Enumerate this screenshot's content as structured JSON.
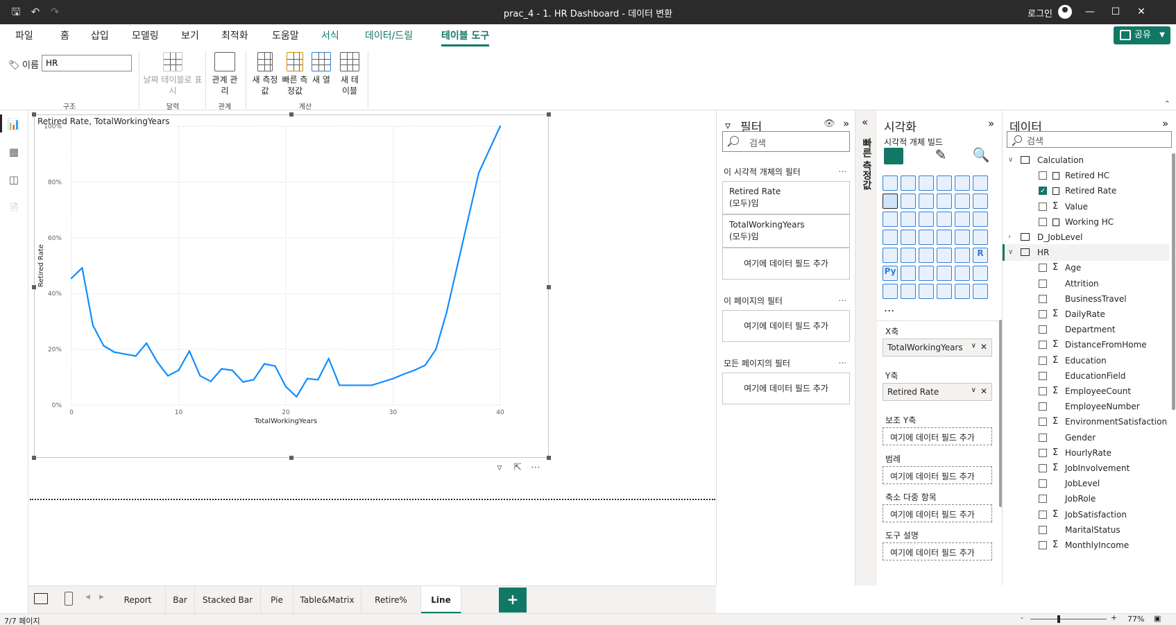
{
  "window": {
    "title": "prac_4 - 1. HR Dashboard - 데이터 변환",
    "login": "로그인"
  },
  "ribbon": {
    "tabs": [
      "파일",
      "홈",
      "삽입",
      "모델링",
      "보기",
      "최적화",
      "도움말",
      "서식",
      "데이터/드릴",
      "테이블 도구"
    ],
    "share": "공유",
    "name_label": "이름",
    "name_value": "HR",
    "groups": {
      "structure": "구조",
      "calendar": "달력",
      "relations": "관계",
      "calc": "계산"
    },
    "buttons": {
      "date_table": "날짜 테이블로 표시",
      "manage_rel": "관계 관리",
      "new_measure": "새 측정값",
      "quick_measure": "빠른 측정값",
      "new_column": "새 열",
      "new_table": "새 테이블"
    }
  },
  "visual": {
    "title": "Retired Rate, TotalWorkingYears"
  },
  "chart_data": {
    "type": "line",
    "xlabel": "TotalWorkingYears",
    "ylabel": "Retired Rate",
    "xlim": [
      0,
      40
    ],
    "ylim": [
      0,
      1
    ],
    "x_ticks": [
      "0",
      "10",
      "20",
      "30",
      "40"
    ],
    "y_ticks": [
      "0%",
      "20%",
      "40%",
      "60%",
      "80%",
      "100%"
    ],
    "grid": true,
    "color": "#118dff",
    "x": [
      0,
      1,
      2,
      3,
      4,
      5,
      6,
      7,
      8,
      9,
      10,
      11,
      12,
      13,
      14,
      15,
      16,
      17,
      18,
      19,
      20,
      21,
      22,
      23,
      24,
      25,
      26,
      27,
      28,
      29,
      30,
      31,
      32,
      33,
      34,
      35,
      36,
      37,
      38,
      39,
      40
    ],
    "values": [
      0.455,
      0.492,
      0.286,
      0.213,
      0.19,
      0.183,
      0.176,
      0.222,
      0.155,
      0.105,
      0.125,
      0.194,
      0.105,
      0.085,
      0.13,
      0.125,
      0.083,
      0.091,
      0.148,
      0.14,
      0.066,
      0.03,
      0.095,
      0.091,
      0.167,
      0.071,
      0.071,
      0.071,
      0.071,
      0.083,
      0.095,
      0.111,
      0.125,
      0.143,
      0.2,
      0.333,
      0.5,
      0.667,
      0.833,
      0.917,
      1.0
    ]
  },
  "filters": {
    "title": "필터",
    "search_placeholder": "검색",
    "visual_section": "이 시각적 개체의 필터",
    "cards": [
      {
        "name": "Retired Rate",
        "state": "(모두)임"
      },
      {
        "name": "TotalWorkingYears",
        "state": "(모두)임"
      }
    ],
    "add_field": "여기에 데이터 필드 추가",
    "page_section": "이 페이지의 필터",
    "all_pages_section": "모든 페이지의 필터",
    "more": "..."
  },
  "build_strip": {
    "label": "빠른 측정값"
  },
  "viz": {
    "title": "시각화",
    "subtitle": "시각적 개체 빌드",
    "more": "...",
    "wells": [
      {
        "label": "X축",
        "field": "TotalWorkingYears"
      },
      {
        "label": "Y축",
        "field": "Retired Rate"
      },
      {
        "label": "보조 Y축",
        "field": ""
      },
      {
        "label": "범례",
        "field": ""
      },
      {
        "label": "축소 다중 항목",
        "field": ""
      },
      {
        "label": "도구 설명",
        "field": ""
      }
    ],
    "add_field": "여기에 데이터 필드 추가",
    "py": "Py",
    "r": "R"
  },
  "data": {
    "title": "데이터",
    "search_placeholder": "검색",
    "tables": [
      {
        "name": "Calculation",
        "fields": [
          {
            "name": "Retired HC",
            "kind": "calc",
            "checked": false
          },
          {
            "name": "Retired Rate",
            "kind": "calc",
            "checked": true
          },
          {
            "name": "Value",
            "kind": "sum",
            "checked": false
          },
          {
            "name": "Working HC",
            "kind": "calc",
            "checked": false
          }
        ]
      },
      {
        "name": "D_JobLevel",
        "fields": []
      },
      {
        "name": "HR",
        "fields": [
          {
            "name": "Age",
            "kind": "sum"
          },
          {
            "name": "Attrition",
            "kind": "text"
          },
          {
            "name": "BusinessTravel",
            "kind": "text"
          },
          {
            "name": "DailyRate",
            "kind": "sum"
          },
          {
            "name": "Department",
            "kind": "text"
          },
          {
            "name": "DistanceFromHome",
            "kind": "sum"
          },
          {
            "name": "Education",
            "kind": "sum"
          },
          {
            "name": "EducationField",
            "kind": "text"
          },
          {
            "name": "EmployeeCount",
            "kind": "sum"
          },
          {
            "name": "EmployeeNumber",
            "kind": "text"
          },
          {
            "name": "EnvironmentSatisfaction",
            "kind": "sum"
          },
          {
            "name": "Gender",
            "kind": "text"
          },
          {
            "name": "HourlyRate",
            "kind": "sum"
          },
          {
            "name": "JobInvolvement",
            "kind": "sum"
          },
          {
            "name": "JobLevel",
            "kind": "text"
          },
          {
            "name": "JobRole",
            "kind": "text"
          },
          {
            "name": "JobSatisfaction",
            "kind": "sum"
          },
          {
            "name": "MaritalStatus",
            "kind": "text"
          },
          {
            "name": "MonthlyIncome",
            "kind": "sum"
          }
        ]
      }
    ]
  },
  "pages": {
    "tabs": [
      "Report",
      "Bar",
      "Stacked Bar",
      "Pie",
      "Table&Matrix",
      "Retire%",
      "Line"
    ],
    "active": "Line",
    "add": "+"
  },
  "status": {
    "page_count": "7/7 페이지",
    "zoom": "77%"
  }
}
